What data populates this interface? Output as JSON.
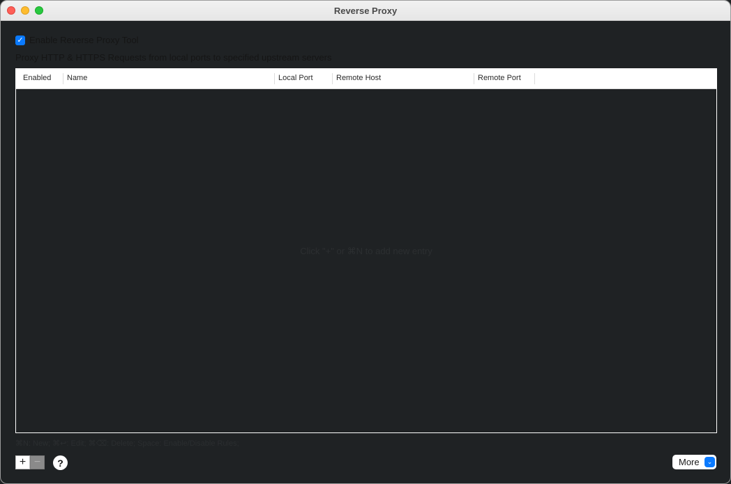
{
  "window": {
    "title": "Reverse Proxy"
  },
  "enable": {
    "label": "Enable Reverse Proxy Tool",
    "checked": true
  },
  "description": "Proxy HTTP & HTTPS Requests from local ports to specified upstream servers",
  "table": {
    "columns": [
      "Enabled",
      "Name",
      "Local Port",
      "Remote Host",
      "Remote Port"
    ],
    "rows": [],
    "empty_message": "Click \"+\" or ⌘N to add new entry"
  },
  "shortcuts_hint": "⌘N: New; ⌘↩: Edit; ⌘⌫: Delete; Space: Enable/Disable Rules;",
  "footer": {
    "add_symbol": "+",
    "remove_symbol": "−",
    "help_symbol": "?",
    "more_label": "More",
    "more_arrow": "⌄"
  },
  "colors": {
    "accent": "#0a7aff",
    "background": "#1f2224",
    "traffic_close": "#fe5f57",
    "traffic_minimize": "#febc2e",
    "traffic_maximize": "#28c840"
  },
  "icons": {
    "checkbox": "checkmark-icon",
    "add": "plus-icon",
    "remove": "minus-icon",
    "help": "question-mark-icon",
    "more": "chevron-down-icon"
  }
}
